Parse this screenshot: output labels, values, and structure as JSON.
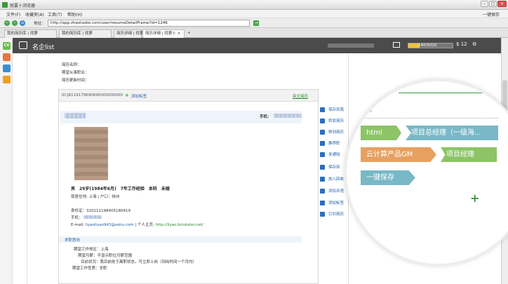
{
  "window": {
    "title": "就要卜浏览器",
    "right_label": "一键保存"
  },
  "menu": [
    "文件(F)",
    "收藏夹(A)",
    "工具(T)",
    "帮助(H)"
  ],
  "address": {
    "label": "地址：",
    "url": "http://app.zhaoluobo.com/user/resumeDetailFrame?id=1246"
  },
  "tabs": [
    "我的简历库 | 找萝",
    "我的简历库 | 找萝",
    "简历详细 | 找萝",
    "简历详细 | 找萝卜",
    "+"
  ],
  "leftbar": [
    "CV",
    "",
    "",
    ""
  ],
  "appbar": {
    "name": "名企list",
    "score": "140/5020",
    "coins": "12"
  },
  "page": {
    "resume_name_label": "简历名称：",
    "job_label": "期望从事职业：",
    "updated_label": "简历更新时间：",
    "id_text": "ID:JR119179690R90000000000",
    "add_tag": "添加标签",
    "english_link": "英文简历",
    "phone_label": "手机：",
    "summary": "男　29岁(1984年6月)　7年工作经验　本科　未婚",
    "residence": "现居住地: 上海 | 户口：徐州",
    "idcard": "身份证：320211198405180419",
    "mobile_label": "手机：",
    "email_line_label": "E-mail:",
    "email": "liyaoliyao943@sohu.com",
    "homepage_label": " | 个人主页:",
    "homepage": "http://liyao.brinkster.net/",
    "section_title": "求职意向",
    "intent": [
      "期望工作地区：上海",
      "期望月薪：不显示职位月薪范围",
      "目前状况：我目前处于离职状态，可立即上岗（到岗时间一个月内）",
      "期望工作性质：全职"
    ]
  },
  "side_actions": [
    "保存到我",
    "转发简历",
    "移到简历",
    "推荐职",
    "发通知",
    "保存到",
    "放入回收",
    "添加评语",
    "添加标签",
    "打印简历"
  ],
  "magnifier": {
    "heading": "签",
    "tags": [
      "html",
      "项目总经理（一级海...",
      "云计算产品GM",
      "项目经理",
      "一键保存"
    ],
    "add_text": "+",
    "colors": {
      "green": "#8cc466",
      "blue": "#79b8c6",
      "orange": "#e6a060",
      "accent": "#3a9a3a"
    }
  }
}
